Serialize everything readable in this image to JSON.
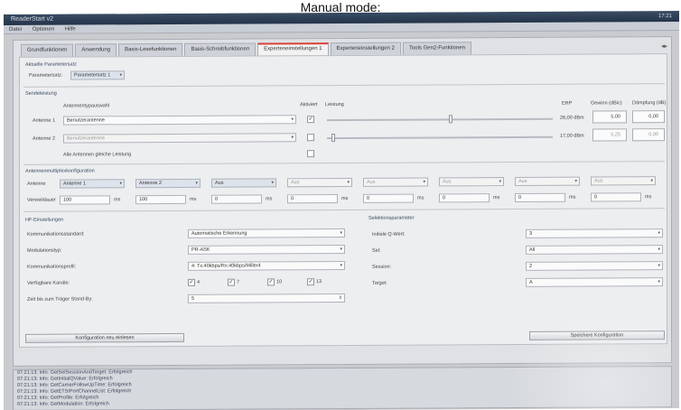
{
  "caption": "Manual mode:",
  "window": {
    "title": "ReaderStart v2",
    "clock": "17:21"
  },
  "menu": [
    "Datei",
    "Optionen",
    "Hilfe"
  ],
  "tabs": [
    {
      "label": "Grundfunktionen"
    },
    {
      "label": "Anwendung"
    },
    {
      "label": "Basis-Lesefunktionen"
    },
    {
      "label": "Basis-Schreibfunktionen"
    },
    {
      "label": "Experteneinstellungen 1",
      "active": true
    },
    {
      "label": "Experteneinstellungen 2"
    },
    {
      "label": "Tools Gen2-Funktionen"
    }
  ],
  "paramset": {
    "section": "Aktuelle Parametersatz",
    "label": "Parametersatz:",
    "value": "Parametersatz 1"
  },
  "sendeleistung": {
    "section": "Sendeleistung",
    "col_antenna": "Antennentypauswahl",
    "col_active": "Aktiviert",
    "col_power": "Leistung",
    "col_erp": "ERP",
    "col_gain": "Gewinn (dBic)",
    "col_damping": "Dämpfung (dB)",
    "rows": [
      {
        "label": "Antenne 1",
        "type": "Benutzerantenne",
        "checked": true,
        "power": "26,00 dBm",
        "gain": "5,00",
        "damping": "0,00",
        "slider": 0.55
      },
      {
        "label": "Antenne 2",
        "type": "Benutzerantenne",
        "checked": false,
        "power": "17,00 dBm",
        "gain": "5,25",
        "damping": "0,00",
        "slider": 0.02
      }
    ],
    "same_power": "Alle Antennen gleiche Leistung"
  },
  "multiplex": {
    "section": "Antennenmultiplexkonfiguration",
    "antenna_label": "Antenne",
    "dwell_label": "Verweildauer",
    "antennas": [
      "Antenne 1",
      "Antenne 2",
      "Aus",
      "Aus",
      "Aus",
      "Aus",
      "Aus",
      "Aus"
    ],
    "dwell": [
      "100",
      "100",
      "0",
      "0",
      "0",
      "0",
      "0",
      "0"
    ],
    "unit": "ms"
  },
  "hf": {
    "section": "HF-Einstellungen",
    "rows": [
      {
        "label": "Kommunikationsstandard:",
        "value": "Automatische Erkennung"
      },
      {
        "label": "Modulationstyp:",
        "value": "PR-ASK"
      },
      {
        "label": "Kommunikationsprofil:",
        "value": "4: Tx:40kbps/Rx:40kbps/Miller4"
      }
    ],
    "channels_label": "Verfügbare Kanäle:",
    "channels": [
      "4",
      "7",
      "10",
      "13"
    ],
    "standby_label": "Zeit bis zum Träger Stand-By:",
    "standby_value": "5"
  },
  "selection": {
    "section": "Selektionsparameter",
    "rows": [
      {
        "label": "Initiale Q-Wert:",
        "value": "3"
      },
      {
        "label": "Sel:",
        "value": "All"
      },
      {
        "label": "Session:",
        "value": "2"
      },
      {
        "label": "Target:",
        "value": "A"
      }
    ]
  },
  "buttons": {
    "reload": "Konfiguration neu einlesen",
    "save": "Speichere Konfiguration"
  },
  "log": [
    "07:21:13: Info: GetSelSessionAndTarget: Erfolgreich",
    "07:21:13: Info: GetInitialQValue: Erfolgreich",
    "07:21:13: Info: GetCarrierFollowUpTime: Erfolgreich",
    "07:21:13: Info: GetETSIPortChannelList: Erfolgreich",
    "07:21:13: Info: GetProfile: Erfolgreich",
    "07:21:13: Info: GetModulation: Erfolgreich"
  ]
}
